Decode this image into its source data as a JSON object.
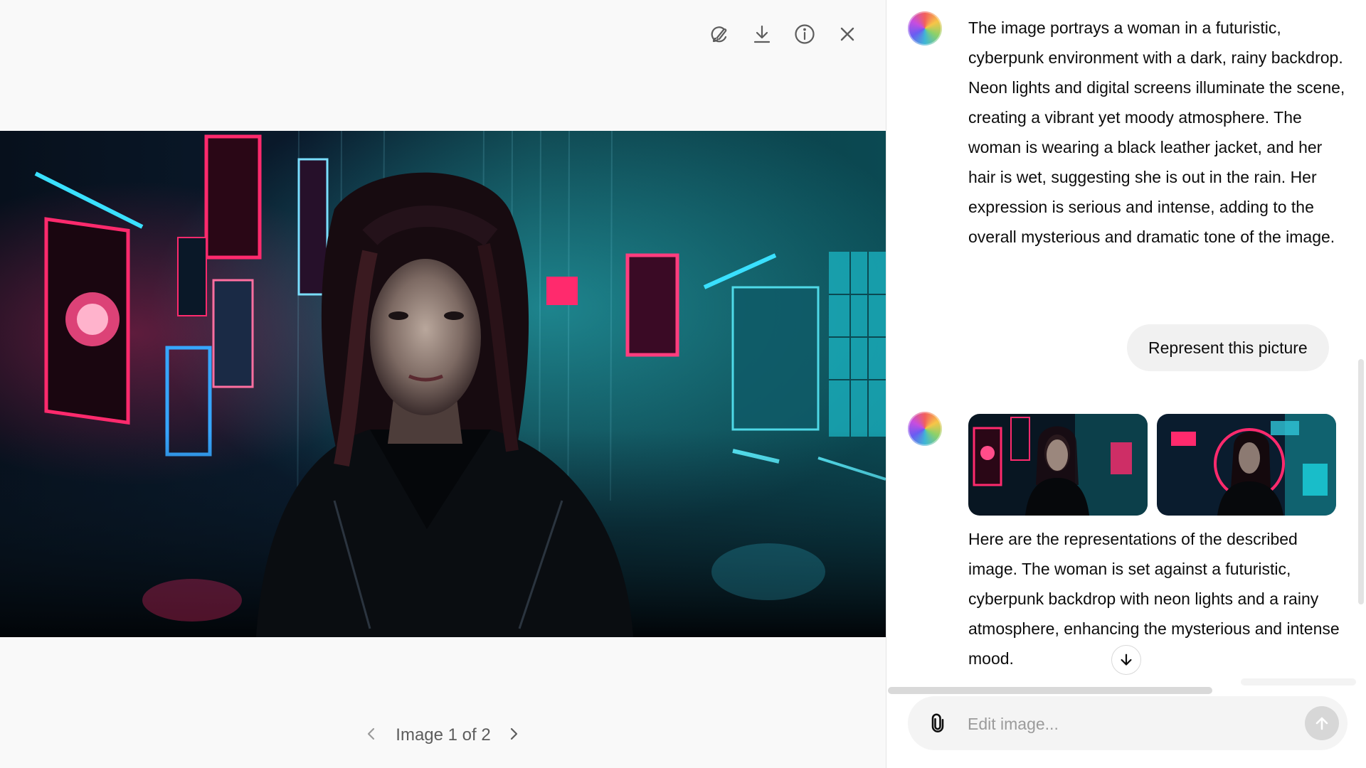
{
  "viewer": {
    "toolbar": {
      "edit_icon": "brush-circle-icon",
      "download_icon": "download-icon",
      "info_icon": "info-icon",
      "close_icon": "close-icon"
    },
    "image": {
      "description_hidden": true
    },
    "pager": {
      "label": "Image 1 of 2",
      "prev_icon": "chevron-left-icon",
      "next_icon": "chevron-right-icon"
    }
  },
  "panel": {
    "assistant_message_1": "The image portrays a woman in a futuristic, cyberpunk environment with a dark, rainy backdrop. Neon lights and digital screens illuminate the scene, creating a vibrant yet moody atmosphere. The woman is wearing a black leather jacket, and her hair is wet, suggesting she is out in the rain. Her expression is serious and intense, adding to the overall mysterious and dramatic tone of the image.",
    "user_message": "Represent this picture",
    "assistant_message_2": "Here are the representations of the described image. The woman is set against a futuristic, cyberpunk backdrop with neon lights and a rainy atmosphere, enhancing the mysterious and intense mood.",
    "composer": {
      "placeholder": "Edit image...",
      "attach_icon": "paperclip-icon",
      "send_icon": "arrow-up-icon"
    },
    "scroll_icon": "arrow-down-icon"
  },
  "colors": {
    "neon_pink": "#ff2a6d",
    "neon_cyan": "#05d9e8",
    "panel_bg": "#ffffff",
    "viewer_bg": "#f9f9f9"
  }
}
